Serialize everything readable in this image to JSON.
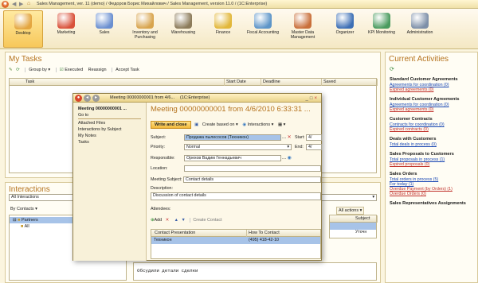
{
  "window": {
    "title": "Sales Management, ver. 11 (demo) / Федоров Борис Михайлович / Sales Management, version 11.0 / (1C:Enterprise)"
  },
  "sections": [
    {
      "label": "Desktop",
      "icon": "desktop-icon",
      "color": "#e4a640"
    },
    {
      "label": "Marketing",
      "icon": "marketing-icon",
      "color": "#d9513a"
    },
    {
      "label": "Sales",
      "icon": "sales-icon",
      "color": "#6a8fd0"
    },
    {
      "label": "Inventory and Purchasing",
      "icon": "inventory-icon",
      "color": "#d8a44d"
    },
    {
      "label": "Warehousing",
      "icon": "warehouse-icon",
      "color": "#8c7b5a"
    },
    {
      "label": "Finance",
      "icon": "finance-icon",
      "color": "#e2b73a"
    },
    {
      "label": "Fiscal Accounting",
      "icon": "fiscal-icon",
      "color": "#5d95c8"
    },
    {
      "label": "Master Data Management",
      "icon": "master-data-icon",
      "color": "#c96f3a"
    },
    {
      "label": "Organizer",
      "icon": "organizer-icon",
      "color": "#3d6fb5"
    },
    {
      "label": "KPI Monitoring",
      "icon": "kpi-icon",
      "color": "#4a9b5e"
    },
    {
      "label": "Administration",
      "icon": "administration-icon",
      "color": "#7d8fa8"
    }
  ],
  "tasks": {
    "title": "My Tasks",
    "toolbar": {
      "group_by": "Group by",
      "executed": "Executed",
      "reassign": "Reassign",
      "accept": "Accept Task"
    },
    "columns": [
      "Task",
      "Start Date",
      "Deadline",
      "Saved"
    ]
  },
  "interactions": {
    "title": "Interactions",
    "filter": "All Interactions",
    "by_contacts": "By Contacts",
    "tree": [
      "Partners",
      "All"
    ],
    "all_actions": "All actions",
    "subject_col": "Subject",
    "subject_cells": [
      "",
      "Уточн"
    ],
    "memo": "Обсудили детали сделки"
  },
  "activities": {
    "title": "Current Activities",
    "groups": [
      {
        "name": "Standard Customer Agreements",
        "links": [
          {
            "text": "Agreements for coordination (0)",
            "red": false
          },
          {
            "text": "Expired agreements (0)",
            "red": true
          }
        ]
      },
      {
        "name": "Individual Customer Agreements",
        "links": [
          {
            "text": "Agreements for coordination (0)",
            "red": false
          },
          {
            "text": "Expired agreements (0)",
            "red": true
          }
        ]
      },
      {
        "name": "Customer Contracts",
        "links": [
          {
            "text": "Contracts for coordination (0)",
            "red": false
          },
          {
            "text": "Expired contracts (0)",
            "red": true
          }
        ]
      },
      {
        "name": "Deals with Customers",
        "links": [
          {
            "text": "Total deals in process (0)",
            "red": false
          }
        ]
      },
      {
        "name": "Sales Proposals to Customers",
        "links": [
          {
            "text": "Total proposals in process (1)",
            "red": false
          },
          {
            "text": "Expired proposals (0)",
            "red": true
          }
        ]
      },
      {
        "name": "Sales Orders",
        "links": [
          {
            "text": "Total orders in process (5)",
            "red": false
          },
          {
            "text": "For today (1)",
            "red": false
          },
          {
            "text": "Overdue Payment (by Orders) (1)",
            "red": true
          },
          {
            "text": "Overdue Orders (0)",
            "red": true
          }
        ]
      },
      {
        "name": "Sales Representatives Assignments",
        "links": []
      }
    ]
  },
  "modal": {
    "title": "Meeting 00000000001 from 4/6...",
    "app": "(1C:Enterprise)",
    "heading": "Meeting 00000000001 from 4/6/2010 6:33:31 ...",
    "nav": [
      "Go to",
      "Attached Files",
      "Interactions by Subject",
      "My Notes",
      "Tasks"
    ],
    "nav_head": "Meeting 00000000001 ...",
    "toolbar": {
      "write_close": "Write and close",
      "create_based": "Create based on",
      "interactions": "Interactions"
    },
    "labels": {
      "subject": "Subject:",
      "priority": "Priority:",
      "responsible": "Responsible:",
      "location": "Location:",
      "start": "Start:",
      "end": "End:",
      "meeting_subject": "Meeting Subject:",
      "description": "Description:",
      "attendees": "Attendees:"
    },
    "values": {
      "subject": "Продажа пылесосов (Техникон)",
      "priority": "Normal",
      "responsible": "Орехов Вадим Геннадьевич",
      "location": "",
      "start": "4/",
      "end": "4/",
      "meeting_subject": "Contact details",
      "description": "Discussion of contact details"
    },
    "attendees_toolbar": {
      "add": "Add",
      "create_contact": "Create Contact"
    },
    "attendees_columns": [
      "Contact Presentation",
      "How To Contact"
    ],
    "attendees_rows": [
      {
        "contact": "Техникон",
        "how": "(495) 418-42-10"
      }
    ]
  }
}
